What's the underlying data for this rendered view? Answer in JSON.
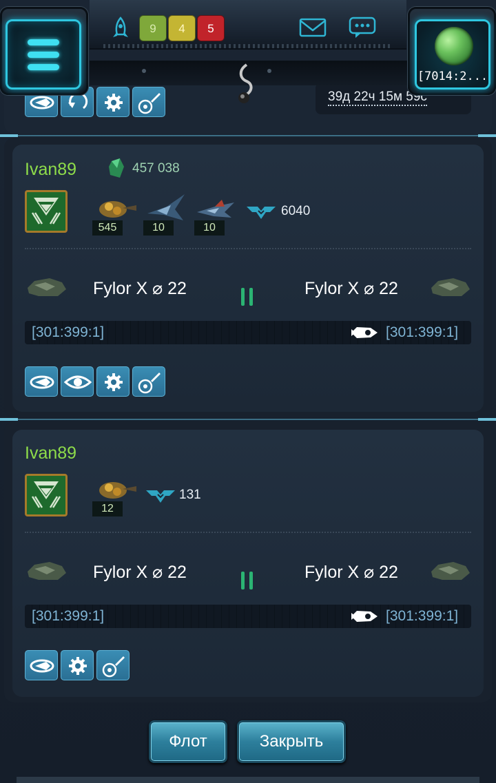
{
  "topbar": {
    "resources": {
      "green": "9",
      "yellow": "4",
      "red": "5"
    },
    "planet_label": "[7014:2..."
  },
  "prev_card": {
    "timer": "39д 22ч 15м 59с"
  },
  "fleets": [
    {
      "owner": "Ivan89",
      "crystal": "457 038",
      "ships": [
        {
          "icon": "bomber-ship-icon",
          "count": "545"
        },
        {
          "icon": "fighter-ship-icon",
          "count": "10"
        },
        {
          "icon": "interceptor-ship-icon",
          "count": "10"
        }
      ],
      "power": "6040",
      "origin": "Fylor X ⌀ 22",
      "destination": "Fylor X ⌀ 22",
      "origin_coord": "[301:399:1]",
      "destination_coord": "[301:399:1]"
    },
    {
      "owner": "Ivan89",
      "ships": [
        {
          "icon": "bomber-ship-icon",
          "count": "12"
        }
      ],
      "power": "131",
      "origin": "Fylor X ⌀ 22",
      "destination": "Fylor X ⌀ 22",
      "origin_coord": "[301:399:1]",
      "destination_coord": "[301:399:1]"
    }
  ],
  "footer": {
    "fleet_label": "Флот",
    "close_label": "Закрыть"
  },
  "colors": {
    "owner": "#8edc4a",
    "accent": "#2fc7e0",
    "button": "#3a8db4",
    "pause": "#2bb473"
  }
}
